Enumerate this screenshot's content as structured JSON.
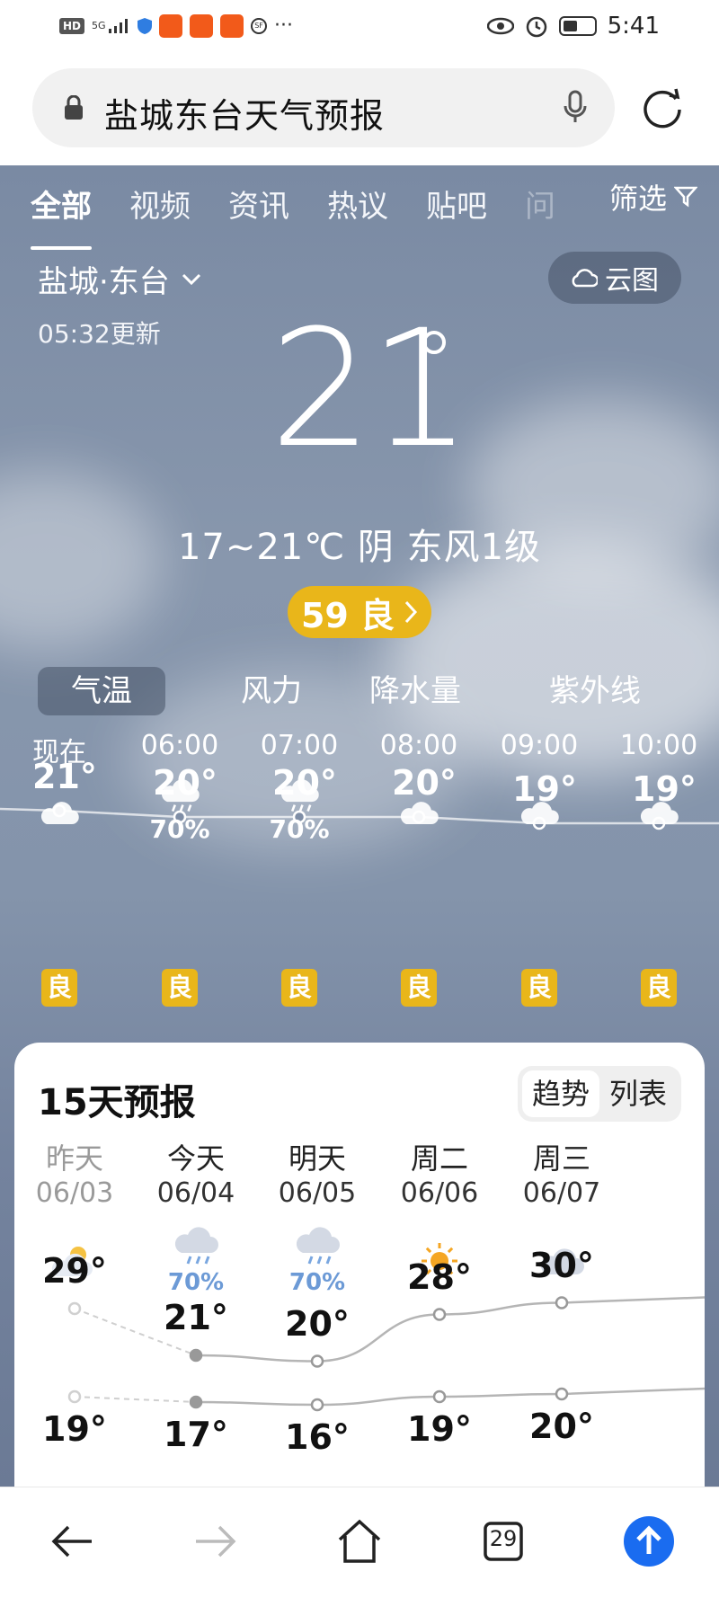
{
  "status_bar": {
    "hd_label": "HD",
    "network_label": "5G",
    "time": "5:41"
  },
  "search": {
    "query": "盐城东台天气预报"
  },
  "tabs": [
    {
      "label": "全部",
      "active": true
    },
    {
      "label": "视频",
      "active": false
    },
    {
      "label": "资讯",
      "active": false
    },
    {
      "label": "热议",
      "active": false
    },
    {
      "label": "贴吧",
      "active": false
    },
    {
      "label": "问",
      "active": false
    }
  ],
  "filter_label": "筛选",
  "weather": {
    "location": "盐城·东台",
    "updated": "05:32更新",
    "cloud_map_label": "云图",
    "current_temp": "21",
    "summary": "17~21℃ 阴 东风1级",
    "aqi_label": "59 良",
    "aqi_color": "#e9b61a",
    "metric_tabs": [
      "气温",
      "风力",
      "降水量",
      "紫外线"
    ],
    "active_metric": "气温",
    "hourly": [
      {
        "time": "现在",
        "icon": "cloudy-icon",
        "precip": "",
        "temp": "21°",
        "aq": "良"
      },
      {
        "time": "06:00",
        "icon": "rain-icon",
        "precip": "70%",
        "temp": "20°",
        "aq": "良"
      },
      {
        "time": "07:00",
        "icon": "rain-icon",
        "precip": "70%",
        "temp": "20°",
        "aq": "良"
      },
      {
        "time": "08:00",
        "icon": "cloudy-icon",
        "precip": "",
        "temp": "20°",
        "aq": "良"
      },
      {
        "time": "09:00",
        "icon": "cloudy-icon",
        "precip": "",
        "temp": "19°",
        "aq": "良"
      },
      {
        "time": "10:00",
        "icon": "cloudy-icon",
        "precip": "",
        "temp": "19°",
        "aq": "良"
      }
    ]
  },
  "forecast": {
    "title": "15天预报",
    "view_trend": "趋势",
    "view_list": "列表",
    "days": [
      {
        "name": "昨天",
        "date": "06/03",
        "icon": "partly-cloudy-icon",
        "precip": "",
        "high": "29°",
        "low": "19°",
        "past": true
      },
      {
        "name": "今天",
        "date": "06/04",
        "icon": "rain-icon",
        "precip": "70%",
        "high": "21°",
        "low": "17°",
        "past": false
      },
      {
        "name": "明天",
        "date": "06/05",
        "icon": "rain-icon",
        "precip": "70%",
        "high": "20°",
        "low": "16°",
        "past": false
      },
      {
        "name": "周二",
        "date": "06/06",
        "icon": "sun-icon",
        "precip": "",
        "high": "28°",
        "low": "19°",
        "past": false
      },
      {
        "name": "周三",
        "date": "06/07",
        "icon": "cloudy-icon",
        "precip": "",
        "high": "30°",
        "low": "20°",
        "past": false
      }
    ]
  },
  "bottom_nav": {
    "tab_count": "29"
  }
}
